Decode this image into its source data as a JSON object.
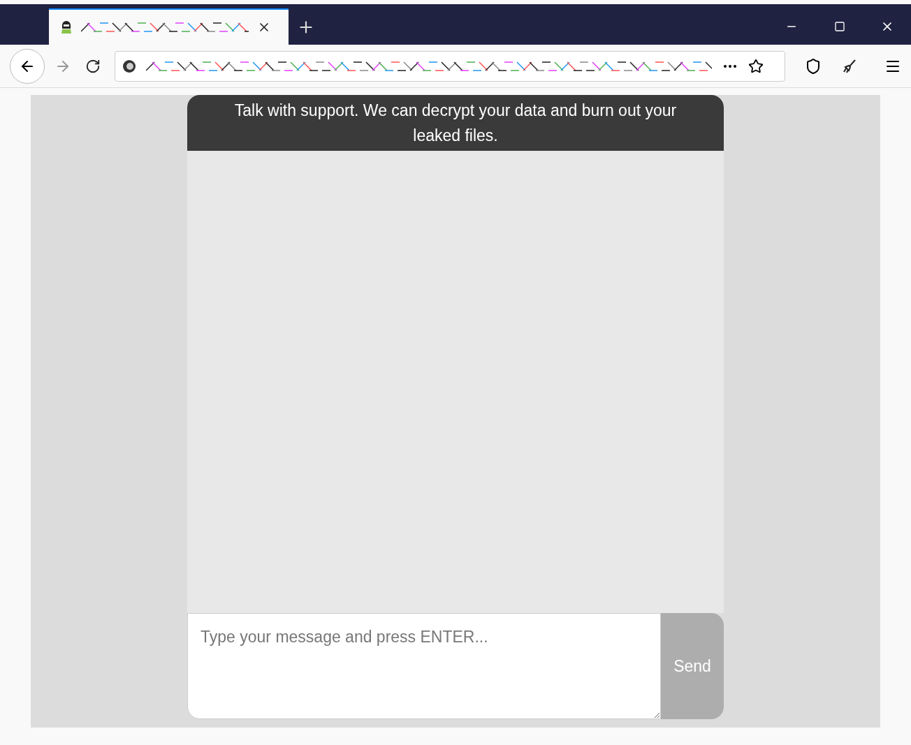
{
  "chat": {
    "header": "Talk with support. We can decrypt your data and burn out your leaked files.",
    "input": {
      "placeholder": "Type your message and press ENTER..."
    },
    "send_button": "Send"
  }
}
